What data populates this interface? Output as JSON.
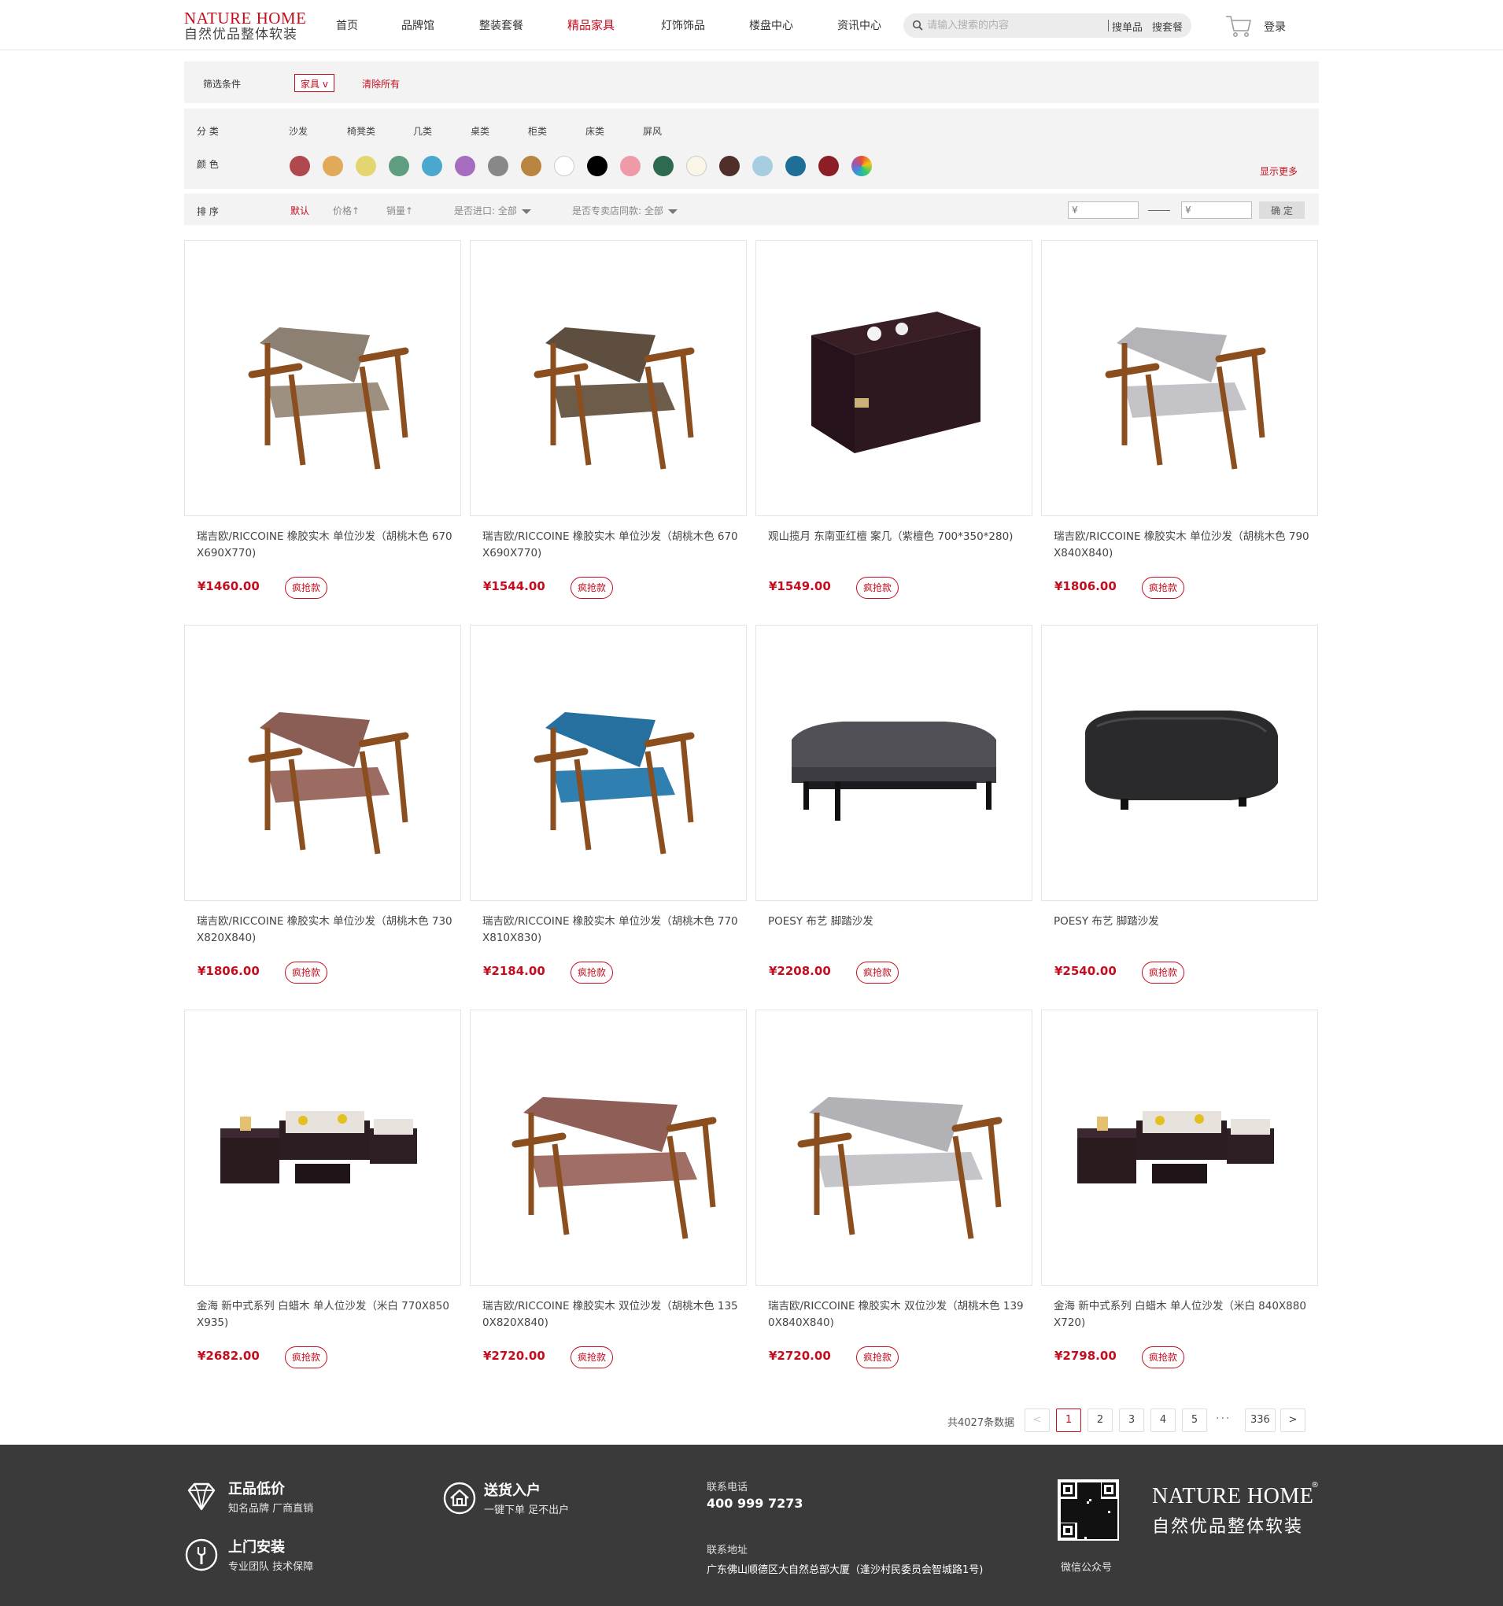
{
  "brand": {
    "name_en": "NATURE HOME",
    "name_cn": "自然优品整体软装",
    "color": "#c40d1e"
  },
  "nav": {
    "items": [
      {
        "label": "首页"
      },
      {
        "label": "品牌馆"
      },
      {
        "label": "整装套餐"
      },
      {
        "label": "精品家具",
        "active": true
      },
      {
        "label": "灯饰饰品"
      },
      {
        "label": "楼盘中心"
      },
      {
        "label": "资讯中心"
      }
    ],
    "search_placeholder": "请输入搜索的内容",
    "search_single": "搜单品",
    "search_package": "搜套餐",
    "cart_icon": "cart-icon",
    "login": "登录"
  },
  "filters": {
    "label": "筛选条件",
    "active_tag": "家具 v",
    "clear_all": "清除所有",
    "category_label": "分 类",
    "categories": [
      "沙发",
      "椅凳类",
      "几类",
      "桌类",
      "柜类",
      "床类",
      "屏风"
    ],
    "color_label": "颜 色",
    "colors": [
      "#b0484d",
      "#e1aa58",
      "#e3d56f",
      "#5e9d7f",
      "#4aa8cf",
      "#a56cc0",
      "#888888",
      "#b8843f",
      "#ffffff",
      "#000000",
      "#ef9aa9",
      "#2e6a4f",
      "#fbf5e8",
      "#4e2f2a",
      "#a6cde0",
      "#1e6f97",
      "#8d1e25",
      "multicolor"
    ],
    "show_more": "显示更多",
    "sort_label": "排 序",
    "sort_default": "默认",
    "sort_price": "价格↑",
    "sort_sales": "销量↑",
    "imported_label": "是否进口: 全部",
    "same_store_label": "是否专卖店同款: 全部",
    "price_min_placeholder": "¥",
    "price_max_placeholder": "¥",
    "confirm": "确 定"
  },
  "products": [
    {
      "title": "瑞吉欧/RICCOINE 橡胶实木 单位沙发（胡桃木色 670X690X770)",
      "price": "¥1460.00",
      "badge": "疯抢款",
      "image": "chair-beige"
    },
    {
      "title": "瑞吉欧/RICCOINE 橡胶实木 单位沙发（胡桃木色 670X690X770)",
      "price": "¥1544.00",
      "badge": "疯抢款",
      "image": "chair-brown"
    },
    {
      "title": "观山揽月 东南亚红檀 案几（紫檀色 700*350*280)",
      "price": "¥1549.00",
      "badge": "疯抢款",
      "image": "tea-table"
    },
    {
      "title": "瑞吉欧/RICCOINE 橡胶实木 单位沙发（胡桃木色 790X840X840)",
      "price": "¥1806.00",
      "badge": "疯抢款",
      "image": "chair-grey"
    },
    {
      "title": "瑞吉欧/RICCOINE 橡胶实木 单位沙发（胡桃木色 730X820X840)",
      "price": "¥1806.00",
      "badge": "疯抢款",
      "image": "chair-pink"
    },
    {
      "title": "瑞吉欧/RICCOINE 橡胶实木 单位沙发（胡桃木色 770X810X830)",
      "price": "¥2184.00",
      "badge": "疯抢款",
      "image": "chair-blue"
    },
    {
      "title": "POESY 布艺 脚踏沙发",
      "price": "¥2208.00",
      "badge": "疯抢款",
      "image": "ottoman-grey"
    },
    {
      "title": "POESY 布艺 脚踏沙发",
      "price": "¥2540.00",
      "badge": "疯抢款",
      "image": "ottoman-black"
    },
    {
      "title": "金海 新中式系列 白蜡木 单人位沙发（米白 770X850X935)",
      "price": "¥2682.00",
      "badge": "疯抢款",
      "image": "sofa-set"
    },
    {
      "title": "瑞吉欧/RICCOINE 橡胶实木 双位沙发（胡桃木色 1350X820X840)",
      "price": "¥2720.00",
      "badge": "疯抢款",
      "image": "loveseat-pink"
    },
    {
      "title": "瑞吉欧/RICCOINE 橡胶实木 双位沙发（胡桃木色 1390X840X840)",
      "price": "¥2720.00",
      "badge": "疯抢款",
      "image": "loveseat-grey"
    },
    {
      "title": "金海 新中式系列 白蜡木 单人位沙发（米白 840X880X720)",
      "price": "¥2798.00",
      "badge": "疯抢款",
      "image": "sofa-set"
    }
  ],
  "pagination": {
    "total": "共4027条数据",
    "prev": "<",
    "pages": [
      "1",
      "2",
      "3",
      "4",
      "5"
    ],
    "ellipsis": "···",
    "last": "336",
    "next": ">"
  },
  "footer": {
    "f1_title": "正品低价",
    "f1_sub": "知名品牌 厂商直销",
    "f2_title": "送货入户",
    "f2_sub": "一键下单 足不出户",
    "f3_title": "上门安装",
    "f3_sub": "专业团队 技术保障",
    "phone_label": "联系电话",
    "phone": "400 999 7273",
    "addr_label": "联系地址",
    "addr": "广东佛山顺德区大自然总部大厦（逢沙村民委员会智城路1号)",
    "qr_label": "微信公众号",
    "logo_en": "NATURE HOME",
    "logo_cn": "自然优品整体软装",
    "reg": "®"
  }
}
